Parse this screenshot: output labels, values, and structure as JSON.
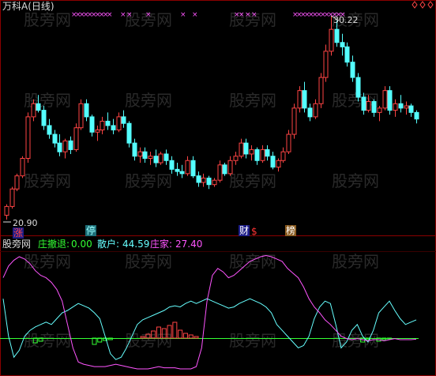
{
  "header": {
    "title": "万科A(日线)"
  },
  "top_chart": {
    "high_label": "30.22",
    "low_label": "20.90",
    "markers": [
      {
        "text": "涨",
        "bg": "#1e1e8a",
        "fg": "#ff4444"
      },
      {
        "text": "停",
        "bg": "#1e6e78",
        "fg": "#9ff"
      },
      {
        "text": "财",
        "bg": "#1e1e8a",
        "fg": "#fff"
      },
      {
        "text": "$",
        "bg": "",
        "fg": "#ff3333"
      },
      {
        "text": "榜",
        "bg": "#8a5a1e",
        "fg": "#fff"
      }
    ]
  },
  "indicator": {
    "name": "股旁网",
    "items": [
      {
        "label": "庄撤退:",
        "value": "0.00",
        "color": "#33ff33"
      },
      {
        "label": "散户:",
        "value": "44.59",
        "color": "#66ffff"
      },
      {
        "label": "庄家:",
        "value": "27.40",
        "color": "#ff55ff"
      }
    ]
  },
  "watermark": "股旁网",
  "colors": {
    "up": "#ff4444",
    "down": "#54ffff",
    "green": "#33ff33",
    "magenta": "#ff55ff",
    "cyan": "#66ffff",
    "grid": "#8b0000",
    "cross": "#ff55ff"
  },
  "chart_data": [
    {
      "type": "candlestick",
      "title": "万科A(日线)",
      "ylim": [
        20.9,
        30.22
      ],
      "candles": [
        [
          21.1,
          21.6,
          20.9,
          21.5
        ],
        [
          21.5,
          22.4,
          21.4,
          22.3
        ],
        [
          22.3,
          23.0,
          22.2,
          22.9
        ],
        [
          22.9,
          23.8,
          22.8,
          23.7
        ],
        [
          23.7,
          25.8,
          23.5,
          25.6
        ],
        [
          25.6,
          26.4,
          25.4,
          26.2
        ],
        [
          26.2,
          26.6,
          25.8,
          25.9
        ],
        [
          25.9,
          26.1,
          25.0,
          25.2
        ],
        [
          25.2,
          25.5,
          24.6,
          24.8
        ],
        [
          24.8,
          25.0,
          24.2,
          24.4
        ],
        [
          24.4,
          24.8,
          23.8,
          24.0
        ],
        [
          24.0,
          24.6,
          23.7,
          24.5
        ],
        [
          24.5,
          24.7,
          23.9,
          24.1
        ],
        [
          24.1,
          25.3,
          24.0,
          25.1
        ],
        [
          25.1,
          26.4,
          25.0,
          26.2
        ],
        [
          26.2,
          26.4,
          25.4,
          25.6
        ],
        [
          25.6,
          25.7,
          24.7,
          24.9
        ],
        [
          24.9,
          25.2,
          24.5,
          25.0
        ],
        [
          25.0,
          25.6,
          24.8,
          25.4
        ],
        [
          25.4,
          25.8,
          25.0,
          25.2
        ],
        [
          25.2,
          25.5,
          24.8,
          25.0
        ],
        [
          25.0,
          25.8,
          24.9,
          25.6
        ],
        [
          25.6,
          25.9,
          25.1,
          25.3
        ],
        [
          25.3,
          25.4,
          24.2,
          24.4
        ],
        [
          24.4,
          24.6,
          23.6,
          23.8
        ],
        [
          23.8,
          24.2,
          23.5,
          24.0
        ],
        [
          24.0,
          24.2,
          23.5,
          23.7
        ],
        [
          23.7,
          24.0,
          23.4,
          23.8
        ],
        [
          23.8,
          24.1,
          23.3,
          23.5
        ],
        [
          23.5,
          24.0,
          23.4,
          23.9
        ],
        [
          23.9,
          24.1,
          23.4,
          23.6
        ],
        [
          23.6,
          23.8,
          23.0,
          23.2
        ],
        [
          23.2,
          23.5,
          22.9,
          23.1
        ],
        [
          23.1,
          23.4,
          22.8,
          23.0
        ],
        [
          23.0,
          23.8,
          22.9,
          23.6
        ],
        [
          23.6,
          23.8,
          22.8,
          22.9
        ],
        [
          22.9,
          23.1,
          22.4,
          22.6
        ],
        [
          22.6,
          23.0,
          22.4,
          22.8
        ],
        [
          22.8,
          22.9,
          22.3,
          22.5
        ],
        [
          22.5,
          22.8,
          22.4,
          22.7
        ],
        [
          22.7,
          23.6,
          22.6,
          23.4
        ],
        [
          23.4,
          23.5,
          22.9,
          23.0
        ],
        [
          23.0,
          23.8,
          22.9,
          23.6
        ],
        [
          23.6,
          24.0,
          23.4,
          23.8
        ],
        [
          23.8,
          24.6,
          23.7,
          24.4
        ],
        [
          24.4,
          24.6,
          23.7,
          23.9
        ],
        [
          23.9,
          24.3,
          23.6,
          24.1
        ],
        [
          24.1,
          24.2,
          23.4,
          23.6
        ],
        [
          23.6,
          24.3,
          23.5,
          24.1
        ],
        [
          24.1,
          24.3,
          23.6,
          23.8
        ],
        [
          23.8,
          24.0,
          23.2,
          23.3
        ],
        [
          23.3,
          23.7,
          23.1,
          23.6
        ],
        [
          23.6,
          24.2,
          23.5,
          24.0
        ],
        [
          24.0,
          25.0,
          23.9,
          24.8
        ],
        [
          24.8,
          26.2,
          24.6,
          26.0
        ],
        [
          26.0,
          27.0,
          25.8,
          26.8
        ],
        [
          26.8,
          27.2,
          25.8,
          26.0
        ],
        [
          26.0,
          26.2,
          25.4,
          25.6
        ],
        [
          25.6,
          26.4,
          25.5,
          26.2
        ],
        [
          26.2,
          27.6,
          26.0,
          27.4
        ],
        [
          27.4,
          28.9,
          27.2,
          28.6
        ],
        [
          28.6,
          30.22,
          28.4,
          29.6
        ],
        [
          29.6,
          30.0,
          28.8,
          29.0
        ],
        [
          29.0,
          29.4,
          28.4,
          28.8
        ],
        [
          28.8,
          29.0,
          27.9,
          28.1
        ],
        [
          28.1,
          28.4,
          27.2,
          27.4
        ],
        [
          27.4,
          27.6,
          26.3,
          26.5
        ],
        [
          26.5,
          26.7,
          25.7,
          25.9
        ],
        [
          25.9,
          26.6,
          25.8,
          26.3
        ],
        [
          26.3,
          26.4,
          25.6,
          25.8
        ],
        [
          25.8,
          26.1,
          25.4,
          26.0
        ],
        [
          26.0,
          27.0,
          25.9,
          26.8
        ],
        [
          26.8,
          27.0,
          25.7,
          25.9
        ],
        [
          25.9,
          26.4,
          25.6,
          26.2
        ],
        [
          26.2,
          26.6,
          25.8,
          26.0
        ],
        [
          26.0,
          26.3,
          25.7,
          26.1
        ],
        [
          26.1,
          26.2,
          25.6,
          25.8
        ],
        [
          25.8,
          25.9,
          25.3,
          25.5
        ]
      ]
    },
    {
      "type": "line",
      "title": "股旁网",
      "ylim": [
        0,
        100
      ],
      "series": [
        {
          "name": "庄撤退",
          "color": "#33ff33",
          "values": [
            0,
            0,
            0,
            0,
            0,
            0,
            -6,
            -4,
            0,
            0,
            0,
            0,
            0,
            0,
            0,
            0,
            0,
            -8,
            -5,
            -3,
            -2,
            0,
            0,
            0,
            0,
            0,
            0,
            0,
            0,
            0,
            0,
            0,
            0,
            0,
            0,
            0,
            0,
            0,
            0,
            0,
            0,
            0,
            0,
            0,
            0,
            0,
            0,
            0,
            0,
            0,
            0,
            0,
            0,
            0,
            0,
            0,
            0,
            0,
            0,
            0,
            0,
            0,
            0,
            0,
            0,
            0,
            0,
            -5,
            -2,
            0,
            -4,
            -2,
            -1,
            0,
            0,
            0,
            0,
            0
          ]
        },
        {
          "name": "散户",
          "color": "#66ffff",
          "values": [
            62,
            30,
            12,
            18,
            30,
            35,
            38,
            40,
            42,
            40,
            45,
            50,
            52,
            55,
            58,
            56,
            54,
            50,
            45,
            30,
            15,
            10,
            12,
            20,
            30,
            40,
            44,
            46,
            48,
            50,
            52,
            55,
            56,
            55,
            58,
            60,
            58,
            60,
            62,
            60,
            58,
            56,
            54,
            55,
            58,
            60,
            62,
            60,
            58,
            55,
            50,
            40,
            35,
            30,
            25,
            20,
            22,
            30,
            45,
            55,
            60,
            58,
            40,
            20,
            25,
            35,
            40,
            30,
            25,
            35,
            50,
            55,
            60,
            52,
            45,
            40,
            42,
            44
          ]
        },
        {
          "name": "庄家",
          "color": "#ff55ff",
          "values": [
            80,
            90,
            95,
            98,
            96,
            92,
            86,
            82,
            80,
            76,
            70,
            60,
            40,
            20,
            8,
            6,
            5,
            4,
            4,
            4,
            5,
            6,
            5,
            4,
            3,
            2,
            2,
            2,
            3,
            4,
            3,
            3,
            3,
            2,
            2,
            2,
            4,
            20,
            60,
            82,
            88,
            85,
            80,
            82,
            86,
            90,
            94,
            96,
            98,
            99,
            98,
            96,
            94,
            88,
            84,
            80,
            72,
            62,
            55,
            50,
            44,
            40,
            35,
            30,
            28,
            27,
            28,
            27,
            26,
            27,
            27,
            26,
            27,
            28,
            27,
            27,
            27,
            27.4
          ]
        },
        {
          "name": "",
          "color": "#ff4444",
          "values": [
            0,
            0,
            0,
            0,
            0,
            0,
            0,
            0,
            0,
            0,
            0,
            0,
            0,
            0,
            0,
            0,
            0,
            0,
            0,
            0,
            0,
            0,
            0,
            0,
            0,
            0,
            2,
            5,
            9,
            14,
            12,
            16,
            20,
            10,
            6,
            4,
            2,
            0,
            0,
            0,
            0,
            0,
            0,
            0,
            0,
            0,
            0,
            0,
            0,
            0,
            0,
            0,
            0,
            0,
            0,
            0,
            0,
            0,
            0,
            0,
            0,
            0,
            0,
            0,
            0,
            0,
            0,
            0,
            0,
            0,
            0,
            0,
            0,
            0,
            0,
            0,
            0,
            0
          ]
        }
      ]
    }
  ]
}
